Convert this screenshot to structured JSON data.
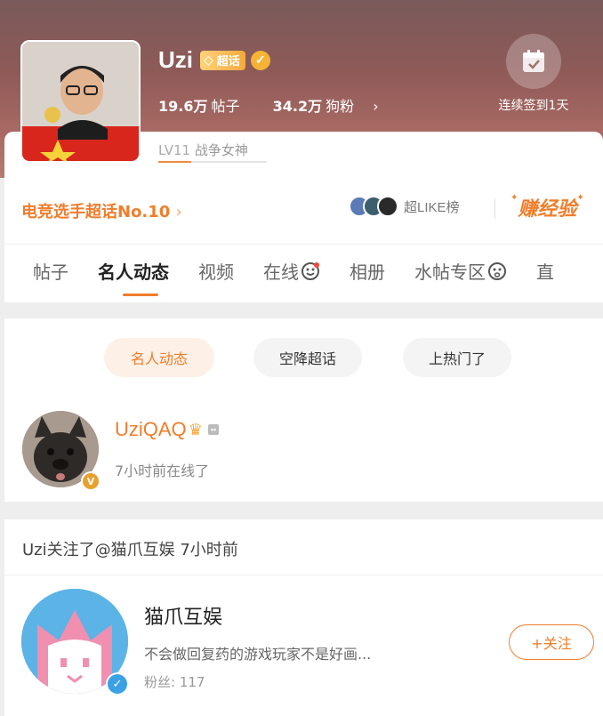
{
  "header": {
    "name": "Uzi",
    "chaohua_badge": "超话",
    "posts_count": "19.6万",
    "posts_label": "帖子",
    "fans_count": "34.2万",
    "fans_label": "狗粉",
    "checkin_label": "连续签到1天",
    "level_code": "LV11",
    "level_title": "战争女神",
    "level_progress": 0.3
  },
  "rank": {
    "label": "电竞选手超话No.10",
    "like_label": "超LIKE榜",
    "earn_label": "赚经验"
  },
  "tabs": [
    {
      "label": "帖子"
    },
    {
      "label": "名人动态"
    },
    {
      "label": "视频"
    },
    {
      "label": "在线"
    },
    {
      "label": "相册"
    },
    {
      "label": "水帖专区"
    },
    {
      "label": "直"
    }
  ],
  "filters": [
    "名人动态",
    "空降超话",
    "上热门了"
  ],
  "celebrity": {
    "name": "UziQAQ",
    "status": "7小时前在线了",
    "v_mark": "V"
  },
  "activity": {
    "text": "Uzi关注了@猫爪互娱 7小时前"
  },
  "followed_account": {
    "name": "猫爪互娱",
    "description": "不会做回复药的游戏玩家不是好画...",
    "fans_label": "粉丝:",
    "fans_count": "117",
    "follow_button": "+关注"
  },
  "colors": {
    "accent": "#f07d2b",
    "header_gradient_top": "#7a5a5a",
    "header_gradient_bottom": "#b57a72"
  }
}
